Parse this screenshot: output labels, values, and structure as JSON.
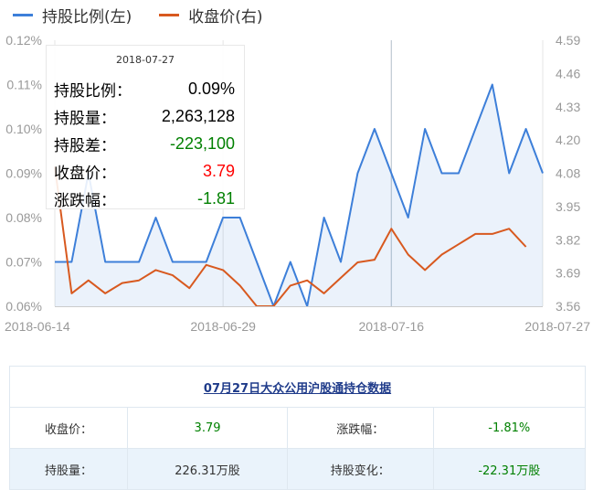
{
  "chart_data": {
    "type": "line",
    "legend": {
      "placement": "top-left"
    },
    "series": [
      {
        "name": "持股比例(左)",
        "axis": "left",
        "color": "#3d7fd9",
        "area": true,
        "values": [
          0.07,
          0.07,
          0.09,
          0.07,
          0.07,
          0.07,
          0.08,
          0.07,
          0.07,
          0.07,
          0.08,
          0.08,
          0.07,
          0.06,
          0.07,
          0.06,
          0.08,
          0.07,
          0.09,
          0.1,
          0.09,
          0.08,
          0.1,
          0.09,
          0.09,
          0.1,
          0.11,
          0.09,
          0.1,
          0.09
        ]
      },
      {
        "name": "收盘价(右)",
        "axis": "right",
        "color": "#d8591f",
        "area": false,
        "values": [
          4.1,
          3.61,
          3.66,
          3.61,
          3.65,
          3.66,
          3.7,
          3.68,
          3.63,
          3.72,
          3.7,
          3.64,
          3.56,
          3.56,
          3.64,
          3.66,
          3.61,
          3.67,
          3.73,
          3.74,
          3.86,
          3.76,
          3.7,
          3.76,
          3.8,
          3.84,
          3.84,
          3.86,
          3.79
        ]
      }
    ],
    "x_ticks": [
      "2018-06-14",
      "2018-06-29",
      "2018-07-16",
      "2018-07-27"
    ],
    "x_tick_index": [
      0,
      10,
      20,
      29
    ],
    "y_left": {
      "ticks": [
        "0.06%",
        "0.07%",
        "0.08%",
        "0.09%",
        "0.10%",
        "0.11%",
        "0.12%"
      ],
      "min": 0.06,
      "max": 0.12
    },
    "y_right": {
      "ticks": [
        "3.56",
        "3.69",
        "3.82",
        "3.95",
        "4.08",
        "4.20",
        "4.33",
        "4.46",
        "4.59"
      ],
      "min": 3.56,
      "max": 4.59
    },
    "highlight_index": 20,
    "grid": "vertical-only"
  },
  "legend": {
    "left_label": "持股比例(左)",
    "right_label": "收盘价(右)",
    "left_color": "#3d7fd9",
    "right_color": "#d8591f"
  },
  "tooltip": {
    "date": "2018-07-27",
    "rows": [
      {
        "label": "持股比例：",
        "value": "0.09%"
      },
      {
        "label": "持股量：",
        "value": "2,263,128"
      },
      {
        "label": "持股差：",
        "value": "-223,100"
      },
      {
        "label": "收盘价：",
        "value": "3.79"
      },
      {
        "label": "涨跌幅：",
        "value": "-1.81"
      }
    ]
  },
  "table": {
    "title": "07月27日大众公用沪股通持仓数据",
    "rows": [
      [
        "收盘价：",
        "3.79",
        "涨跌幅：",
        "-1.81%"
      ],
      [
        "持股量：",
        "226.31万股",
        "持股变化：",
        "-22.31万股"
      ]
    ]
  }
}
